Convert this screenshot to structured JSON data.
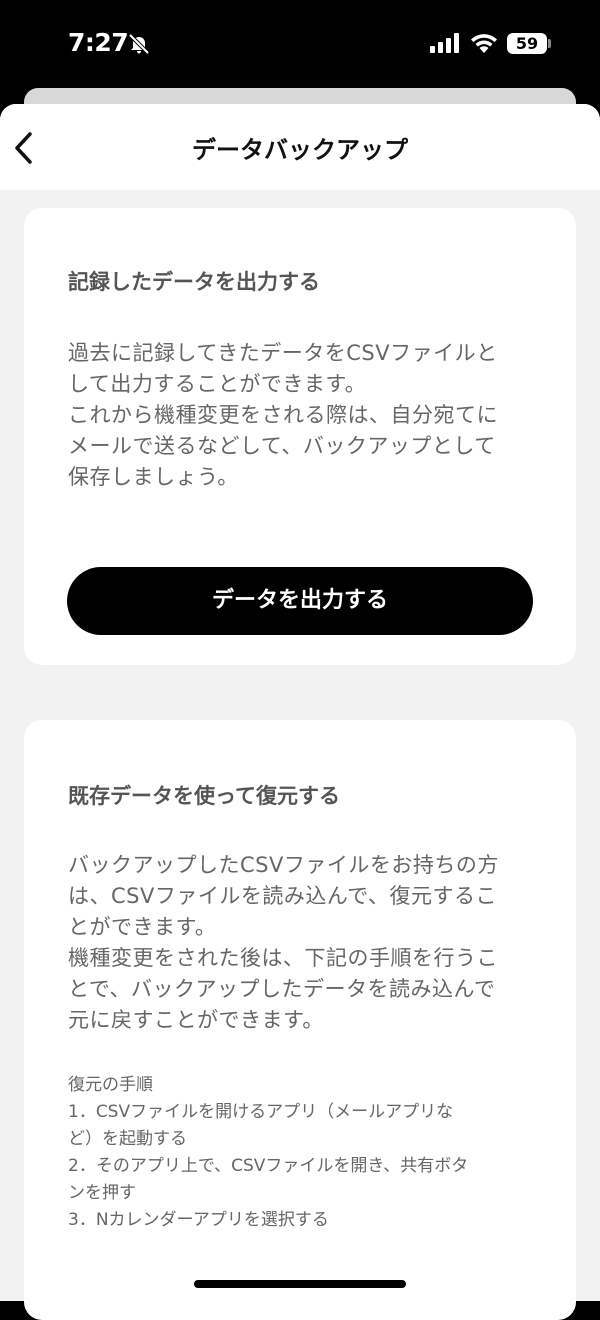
{
  "status_bar": {
    "time": "7:27",
    "battery": "59"
  },
  "nav": {
    "title": "データバックアップ"
  },
  "export_card": {
    "title": "記録したデータを出力する",
    "body": "過去に記録してきたデータをCSVファイルと\nして出力することができます。\nこれから機種変更をされる際は、自分宛てに\nメールで送るなどして、バックアップとして\n保存しましょう。",
    "button_label": "データを出力する"
  },
  "restore_card": {
    "title": "既存データを使って復元する",
    "body": "バックアップしたCSVファイルをお持ちの方\nは、CSVファイルを読み込んで、復元するこ\nとができます。\n機種変更をされた後は、下記の手順を行うこ\nとで、バックアップしたデータを読み込んで\n元に戻すことができます。",
    "steps": "復元の手順\n1．CSVファイルを開けるアプリ（メールアプリな\nど）を起動する\n2．そのアプリ上で、CSVファイルを開き、共有ボタ\nンを押す\n3．Nカレンダーアプリを選択する"
  },
  "icons": {
    "status": [
      "bell-slash-icon",
      "signal-icon",
      "wifi-icon",
      "battery-icon"
    ],
    "nav": [
      "chevron-left-icon"
    ]
  },
  "colors": {
    "button_bg": "#000000",
    "button_text": "#ffffff",
    "sheet_bg": "#f2f2f2",
    "card_bg": "#ffffff"
  }
}
